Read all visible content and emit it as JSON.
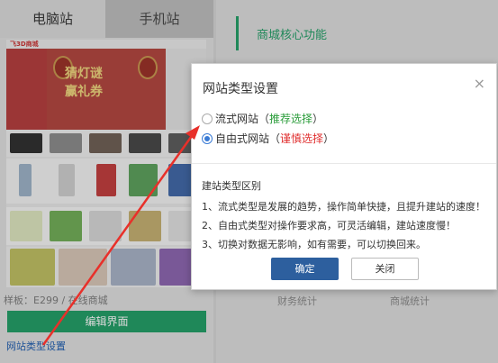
{
  "left_panel": {
    "tabs": {
      "pc": "电脑站",
      "mobile": "手机站"
    },
    "preview": {
      "logo": "飞3D商城",
      "banner_line1": "猜灯谜",
      "banner_line2": "赢礼券"
    },
    "caption": "样板：E299 / 在线商城",
    "edit_button": "编辑界面",
    "site_type_link": "网站类型设置"
  },
  "right_panel": {
    "title": "商城核心功能",
    "labels": [
      "财务统计",
      "商城统计"
    ]
  },
  "dialog": {
    "title": "网站类型设置",
    "close_glyph": "×",
    "options": [
      {
        "name": "流式网站",
        "paren_open": "（",
        "note": "推荐选择",
        "paren_close": "）",
        "selected": false
      },
      {
        "name": "自由式网站",
        "paren_open": "（",
        "note": "谨慎选择",
        "paren_close": "）",
        "selected": true
      }
    ],
    "info_title": "建站类型区别",
    "info_lines": [
      "1、流式类型是发展的趋势，操作简单快捷，且提升建站的速度！",
      "2、自由式类型对操作要求高，可灵活编辑，建站速度慢！",
      "3、切换对数据无影响，如有需要，可以切换回来。"
    ],
    "ok_button": "确定",
    "close_button": "关闭"
  },
  "colors": {
    "accent_green": "#1e9e65",
    "primary_blue": "#2d5f9e",
    "recommend_green": "#2a9c3a",
    "warn_red": "#e03030",
    "arrow_red": "#e8302a"
  }
}
